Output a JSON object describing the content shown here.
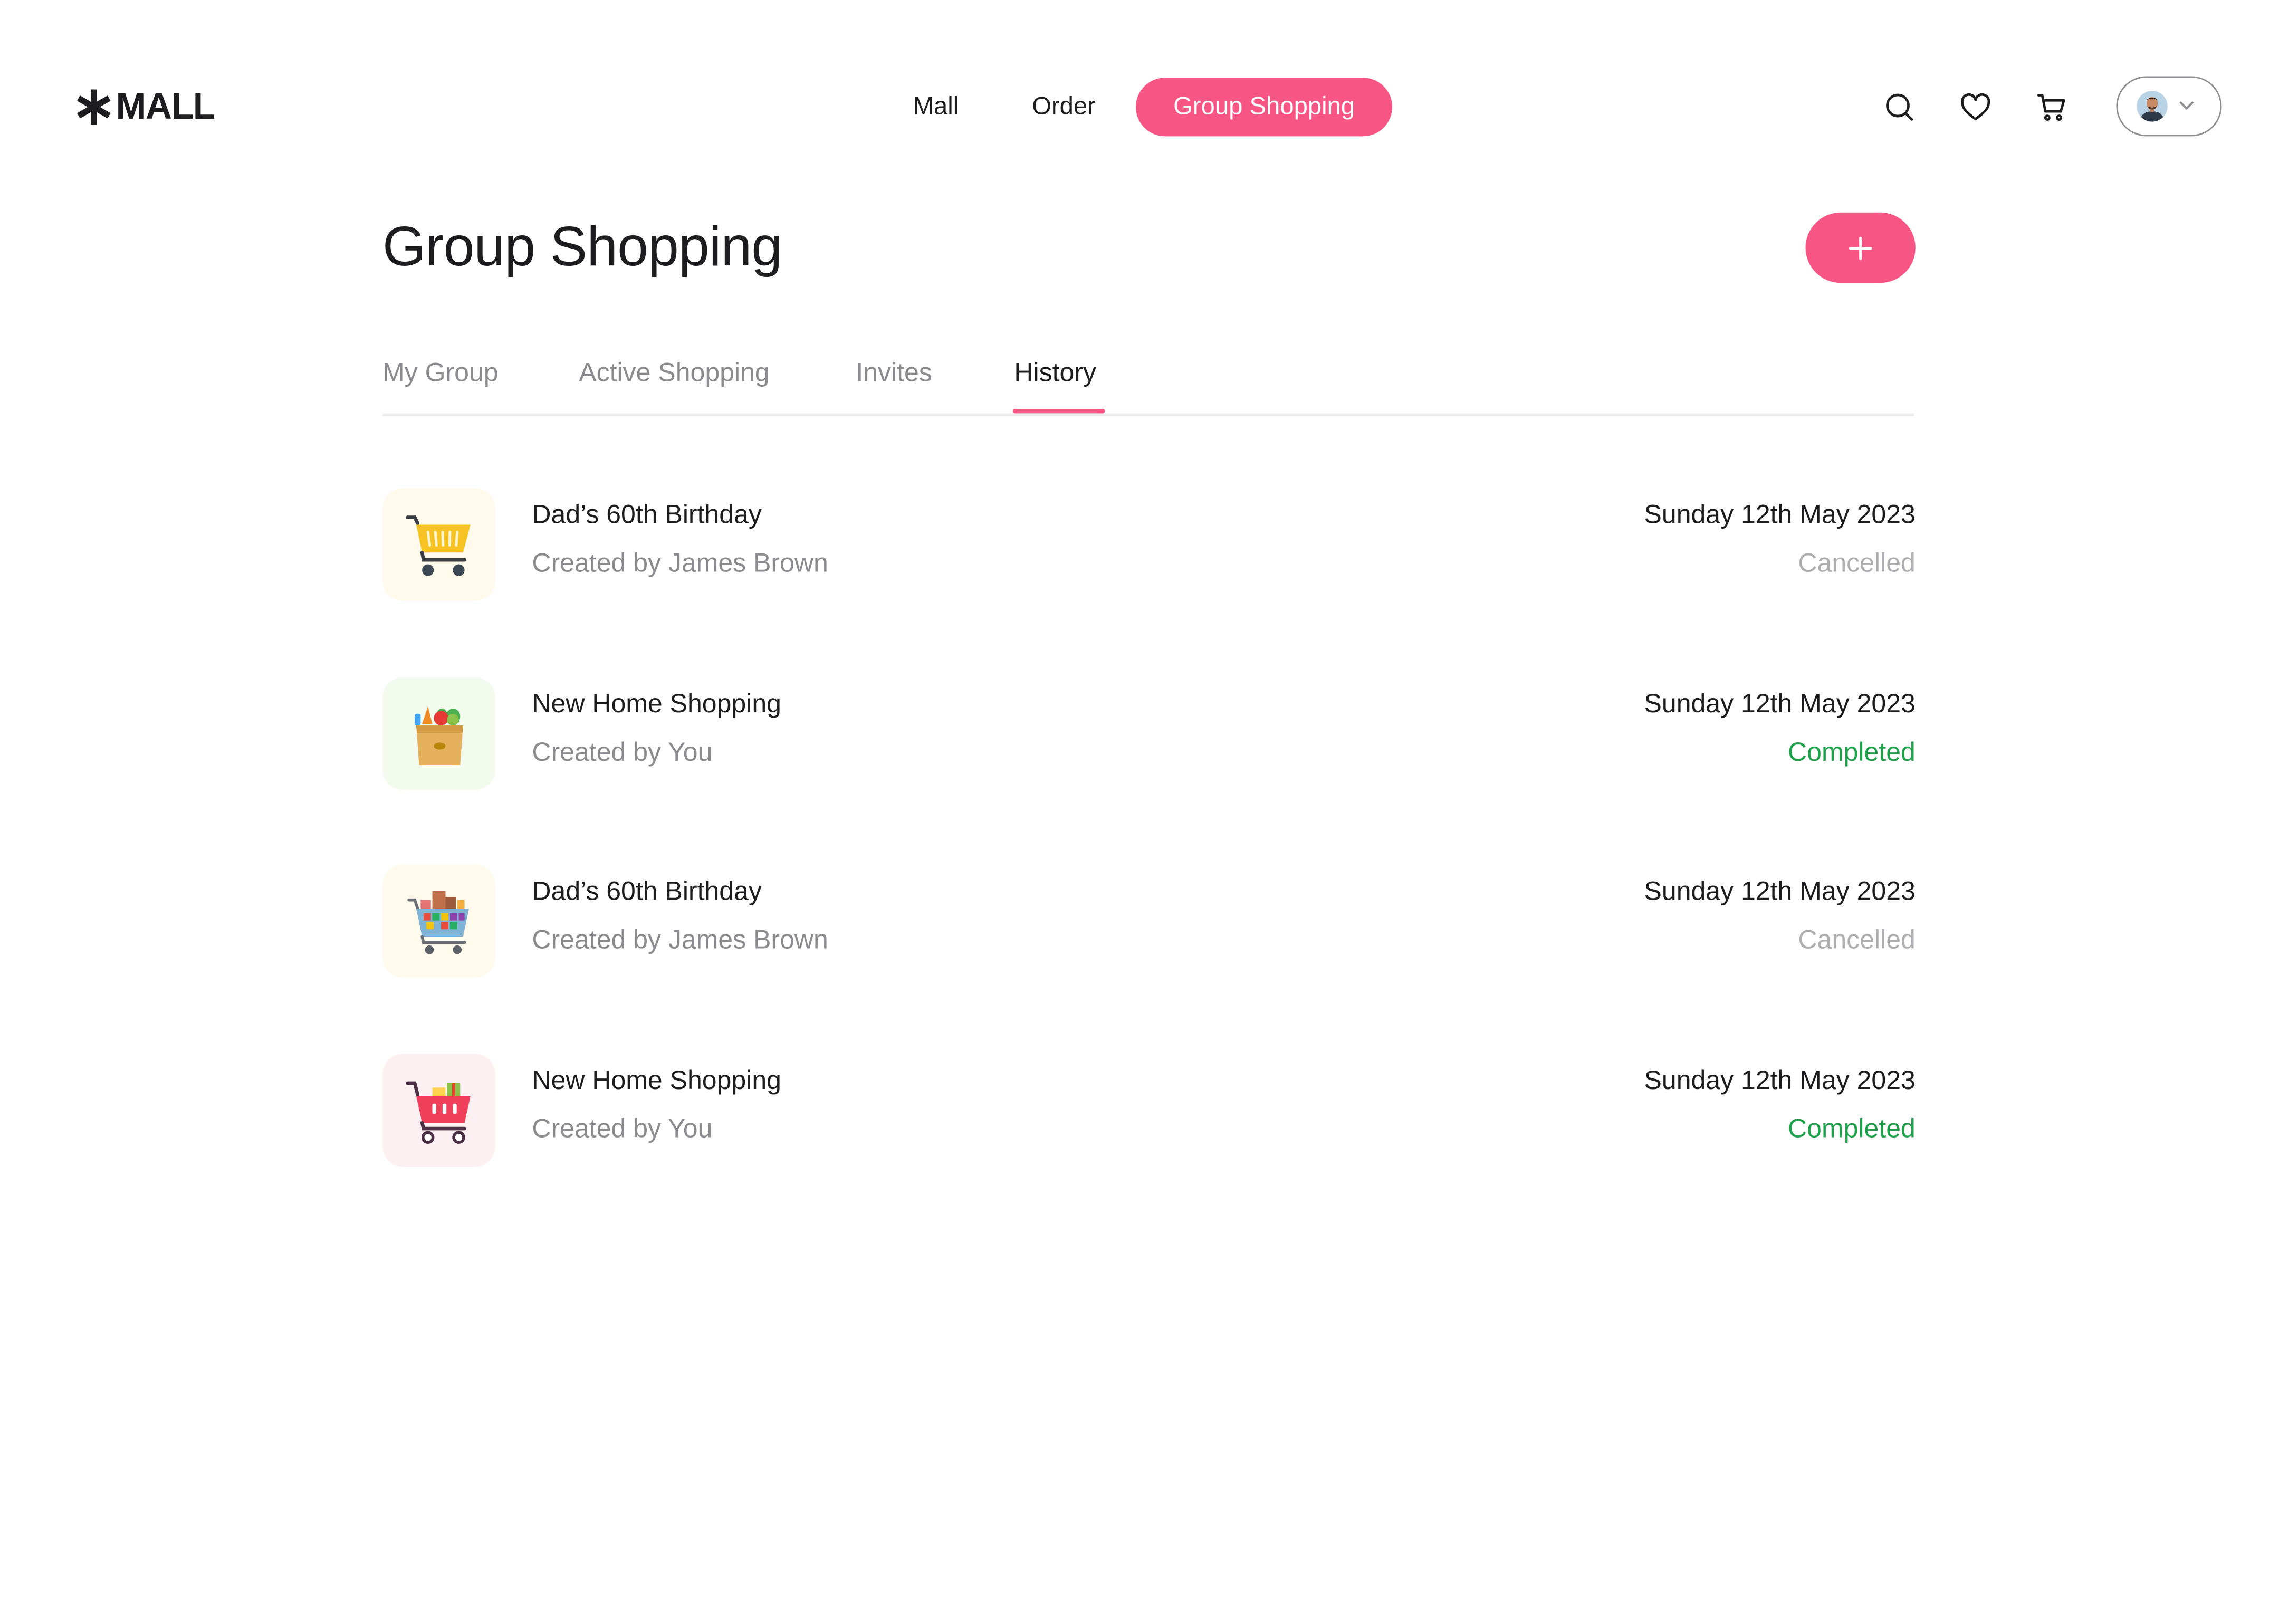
{
  "brand": {
    "logo_text": "MALL"
  },
  "nav": {
    "items": [
      {
        "label": "Mall"
      },
      {
        "label": "Order"
      },
      {
        "label": "Group Shopping",
        "active": true
      }
    ]
  },
  "header_icons": [
    "search-icon",
    "heart-icon",
    "cart-icon",
    "avatar",
    "chevron-down-icon"
  ],
  "page": {
    "title": "Group Shopping",
    "add_icon": "plus-icon"
  },
  "tabs": [
    {
      "label": "My Group"
    },
    {
      "label": "Active Shopping"
    },
    {
      "label": "Invites"
    },
    {
      "label": "History",
      "active": true
    }
  ],
  "history": [
    {
      "title": "Dad’s 60th Birthday",
      "creator": "Created by James Brown",
      "date": "Sunday 12th May 2023",
      "status": "Cancelled",
      "icon": "yellow-cart-icon"
    },
    {
      "title": "New Home Shopping",
      "creator": "Created by You",
      "date": "Sunday 12th May 2023",
      "status": "Completed",
      "icon": "grocery-bag-icon"
    },
    {
      "title": "Dad’s 60th Birthday",
      "creator": "Created by James Brown",
      "date": "Sunday 12th May 2023",
      "status": "Cancelled",
      "icon": "full-cart-icon"
    },
    {
      "title": "New Home Shopping",
      "creator": "Created by You",
      "date": "Sunday 12th May 2023",
      "status": "Completed",
      "icon": "red-cart-icon"
    }
  ],
  "colors": {
    "accent": "#f75584",
    "completed": "#1fa04a",
    "cancelled": "#aeaeb2"
  }
}
